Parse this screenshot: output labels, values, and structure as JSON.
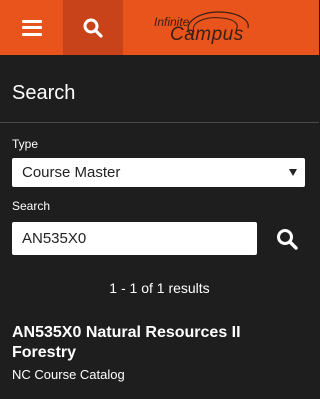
{
  "header": {
    "menu_icon": "hamburger-menu-icon",
    "search_icon": "search-icon",
    "logo": {
      "line1": "Infinite",
      "line2": "Campus"
    },
    "colors": {
      "bar": "#e8541c",
      "active": "#c9431a"
    }
  },
  "page": {
    "title": "Search"
  },
  "form": {
    "type_label": "Type",
    "type_value": "Course Master",
    "search_label": "Search",
    "search_value": "AN535X0",
    "submit_icon": "search-icon"
  },
  "results": {
    "count_text": "1 - 1 of 1 results",
    "items": [
      {
        "title": "AN535X0 Natural Resources II Forestry",
        "subtitle": "NC Course Catalog"
      }
    ]
  }
}
